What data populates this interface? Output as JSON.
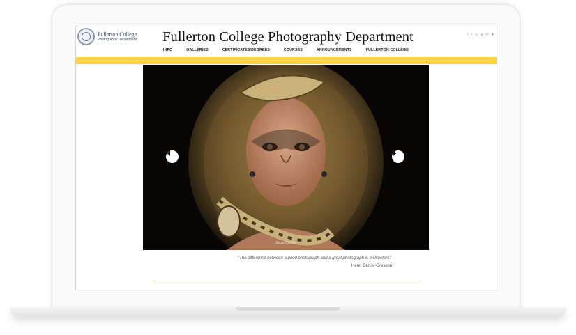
{
  "site": {
    "logo_college": "Fullerton College",
    "logo_dept": "Photography Department",
    "title": "Fullerton College Photography Department"
  },
  "social_icons": [
    "facebook-icon",
    "twitter-icon",
    "instagram-icon",
    "flickr-icon",
    "email-icon",
    "search-icon"
  ],
  "nav": {
    "items": [
      {
        "label": "INFO"
      },
      {
        "label": "GALLERIES"
      },
      {
        "label": "CERTIFICATES/DEGREES"
      },
      {
        "label": "COURSES"
      },
      {
        "label": "ANNOUNCEMENTS"
      },
      {
        "label": "FULLERTON COLLEGE"
      }
    ]
  },
  "slider": {
    "caption": "Jorge Carrillo"
  },
  "quote": {
    "text": "\"The difference between a good photograph and a great photograph is millimeters\"",
    "author": "Henri Cartier-Bresson"
  },
  "colors": {
    "accent_yellow": "#fdd63d",
    "logo_blue": "#31476a"
  }
}
